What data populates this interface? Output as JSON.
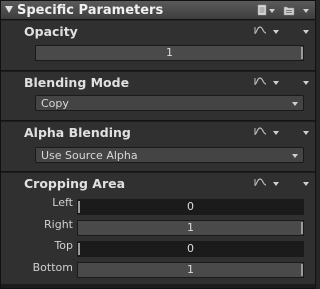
{
  "panel": {
    "title": "Specific Parameters",
    "icons": [
      "page-icon",
      "folder-icon"
    ]
  },
  "opacity": {
    "title": "Opacity",
    "value": "1",
    "level": 1.0
  },
  "blending_mode": {
    "title": "Blending Mode",
    "selected": "Copy"
  },
  "alpha_blending": {
    "title": "Alpha Blending",
    "selected": "Use Source Alpha"
  },
  "cropping_area": {
    "title": "Cropping Area",
    "rows": [
      {
        "label": "Left",
        "value": "0",
        "level": 0.0
      },
      {
        "label": "Right",
        "value": "1",
        "level": 1.0
      },
      {
        "label": "Top",
        "value": "0",
        "level": 0.0
      },
      {
        "label": "Bottom",
        "value": "1",
        "level": 1.0
      }
    ]
  },
  "colors": {
    "background": "#262626",
    "section_bg": "#303030",
    "header_bg": "#4a4a4a",
    "text": "#d8d8d8"
  }
}
